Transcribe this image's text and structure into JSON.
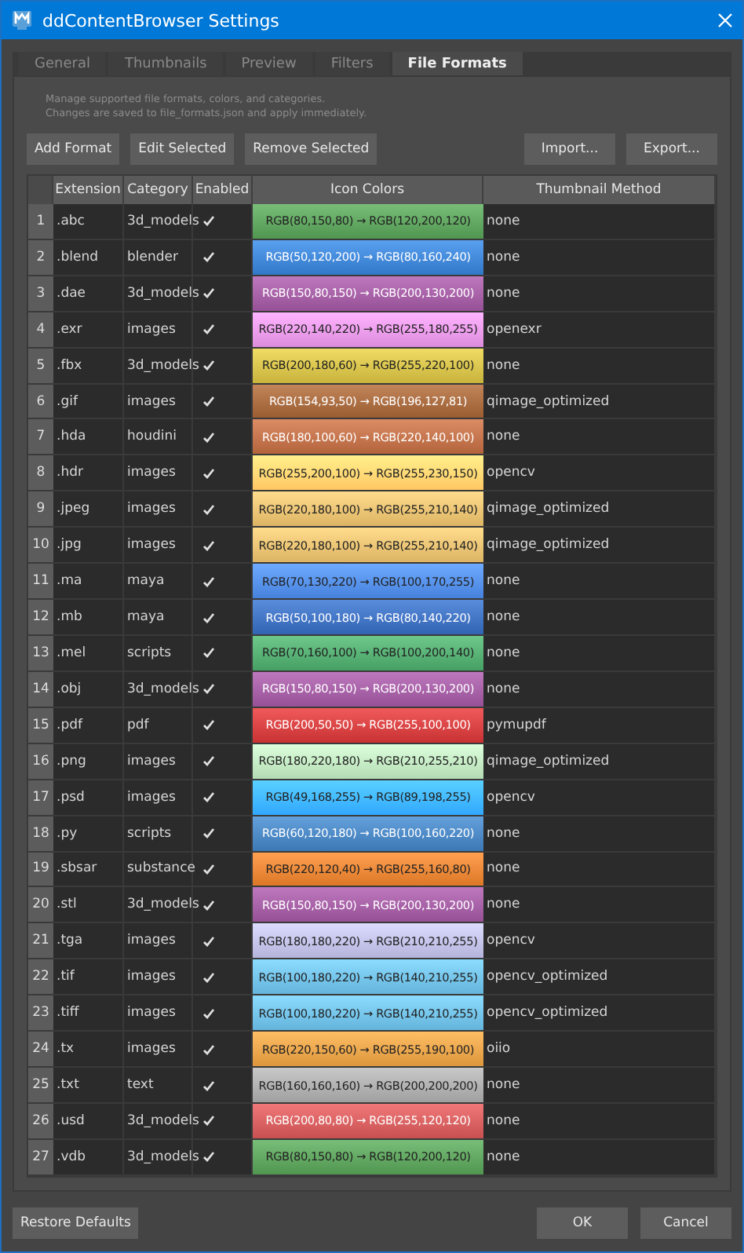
{
  "window": {
    "title": "ddContentBrowser Settings"
  },
  "tabs": [
    {
      "label": "General",
      "selected": false
    },
    {
      "label": "Thumbnails",
      "selected": false
    },
    {
      "label": "Preview",
      "selected": false
    },
    {
      "label": "Filters",
      "selected": false
    },
    {
      "label": "File Formats",
      "selected": true
    }
  ],
  "description": [
    "Manage supported file formats, colors, and categories.",
    "Changes are saved to file_formats.json and apply immediately."
  ],
  "toolbar_left": [
    "Add Format",
    "Edit Selected",
    "Remove Selected"
  ],
  "toolbar_right": [
    "Import...",
    "Export..."
  ],
  "table": {
    "columns": [
      "Extension",
      "Category",
      "Enabled",
      "Icon Colors",
      "Thumbnail Method"
    ],
    "rows": [
      {
        "number": "1",
        "extension": ".abc",
        "category": "3d_models",
        "enabled": true,
        "colors": "RGB(80,150,80) → RGB(120,200,120)",
        "color": "#509650",
        "method": "none"
      },
      {
        "number": "2",
        "extension": ".blend",
        "category": "blender",
        "enabled": true,
        "colors": "RGB(50,120,200) → RGB(80,160,240)",
        "color": "#3278c8",
        "method": "none"
      },
      {
        "number": "3",
        "extension": ".dae",
        "category": "3d_models",
        "enabled": true,
        "colors": "RGB(150,80,150) → RGB(200,130,200)",
        "color": "#965096",
        "method": "none"
      },
      {
        "number": "4",
        "extension": ".exr",
        "category": "images",
        "enabled": true,
        "colors": "RGB(220,140,220) → RGB(255,180,255)",
        "color": "#dc8cdc",
        "method": "openexr"
      },
      {
        "number": "5",
        "extension": ".fbx",
        "category": "3d_models",
        "enabled": true,
        "colors": "RGB(200,180,60) → RGB(255,220,100)",
        "color": "#c8b43c",
        "method": "none"
      },
      {
        "number": "6",
        "extension": ".gif",
        "category": "images",
        "enabled": true,
        "colors": "RGB(154,93,50) → RGB(196,127,81)",
        "color": "#9a5d32",
        "method": "qimage_optimized"
      },
      {
        "number": "7",
        "extension": ".hda",
        "category": "houdini",
        "enabled": true,
        "colors": "RGB(180,100,60) → RGB(220,140,100)",
        "color": "#b4643c",
        "method": "none"
      },
      {
        "number": "8",
        "extension": ".hdr",
        "category": "images",
        "enabled": true,
        "colors": "RGB(255,200,100) → RGB(255,230,150)",
        "color": "#ffc864",
        "method": "opencv"
      },
      {
        "number": "9",
        "extension": ".jpeg",
        "category": "images",
        "enabled": true,
        "colors": "RGB(220,180,100) → RGB(255,210,140)",
        "color": "#dcb464",
        "method": "qimage_optimized"
      },
      {
        "number": "10",
        "extension": ".jpg",
        "category": "images",
        "enabled": true,
        "colors": "RGB(220,180,100) → RGB(255,210,140)",
        "color": "#dcb464",
        "method": "qimage_optimized"
      },
      {
        "number": "11",
        "extension": ".ma",
        "category": "maya",
        "enabled": true,
        "colors": "RGB(70,130,220) → RGB(100,170,255)",
        "color": "#4682dc",
        "method": "none"
      },
      {
        "number": "12",
        "extension": ".mb",
        "category": "maya",
        "enabled": true,
        "colors": "RGB(50,100,180) → RGB(80,140,220)",
        "color": "#3264b4",
        "method": "none"
      },
      {
        "number": "13",
        "extension": ".mel",
        "category": "scripts",
        "enabled": true,
        "colors": "RGB(70,160,100) → RGB(100,200,140)",
        "color": "#46a064",
        "method": "none"
      },
      {
        "number": "14",
        "extension": ".obj",
        "category": "3d_models",
        "enabled": true,
        "colors": "RGB(150,80,150) → RGB(200,130,200)",
        "color": "#965096",
        "method": "none"
      },
      {
        "number": "15",
        "extension": ".pdf",
        "category": "pdf",
        "enabled": true,
        "colors": "RGB(200,50,50) → RGB(255,100,100)",
        "color": "#c83232",
        "method": "pymupdf"
      },
      {
        "number": "16",
        "extension": ".png",
        "category": "images",
        "enabled": true,
        "colors": "RGB(180,220,180) → RGB(210,255,210)",
        "color": "#b4dcb4",
        "method": "qimage_optimized"
      },
      {
        "number": "17",
        "extension": ".psd",
        "category": "images",
        "enabled": true,
        "colors": "RGB(49,168,255) → RGB(89,198,255)",
        "color": "#31a8ff",
        "method": "opencv"
      },
      {
        "number": "18",
        "extension": ".py",
        "category": "scripts",
        "enabled": true,
        "colors": "RGB(60,120,180) → RGB(100,160,220)",
        "color": "#3c78b4",
        "method": "none"
      },
      {
        "number": "19",
        "extension": ".sbsar",
        "category": "substance",
        "enabled": true,
        "colors": "RGB(220,120,40) → RGB(255,160,80)",
        "color": "#dc7828",
        "method": "none"
      },
      {
        "number": "20",
        "extension": ".stl",
        "category": "3d_models",
        "enabled": true,
        "colors": "RGB(150,80,150) → RGB(200,130,200)",
        "color": "#965096",
        "method": "none"
      },
      {
        "number": "21",
        "extension": ".tga",
        "category": "images",
        "enabled": true,
        "colors": "RGB(180,180,220) → RGB(210,210,255)",
        "color": "#b4b4dc",
        "method": "opencv"
      },
      {
        "number": "22",
        "extension": ".tif",
        "category": "images",
        "enabled": true,
        "colors": "RGB(100,180,220) → RGB(140,210,255)",
        "color": "#64b4dc",
        "method": "opencv_optimized"
      },
      {
        "number": "23",
        "extension": ".tiff",
        "category": "images",
        "enabled": true,
        "colors": "RGB(100,180,220) → RGB(140,210,255)",
        "color": "#64b4dc",
        "method": "opencv_optimized"
      },
      {
        "number": "24",
        "extension": ".tx",
        "category": "images",
        "enabled": true,
        "colors": "RGB(220,150,60) → RGB(255,190,100)",
        "color": "#dc963c",
        "method": "oiio"
      },
      {
        "number": "25",
        "extension": ".txt",
        "category": "text",
        "enabled": true,
        "colors": "RGB(160,160,160) → RGB(200,200,200)",
        "color": "#a0a0a0",
        "method": "none"
      },
      {
        "number": "26",
        "extension": ".usd",
        "category": "3d_models",
        "enabled": true,
        "colors": "RGB(200,80,80) → RGB(255,120,120)",
        "color": "#c85050",
        "method": "none"
      },
      {
        "number": "27",
        "extension": ".vdb",
        "category": "3d_models",
        "enabled": true,
        "colors": "RGB(80,150,80) → RGB(120,200,120)",
        "color": "#509650",
        "method": "none"
      }
    ]
  },
  "footer_left": [
    "Restore Defaults"
  ],
  "footer_right": [
    "OK",
    "Cancel"
  ]
}
